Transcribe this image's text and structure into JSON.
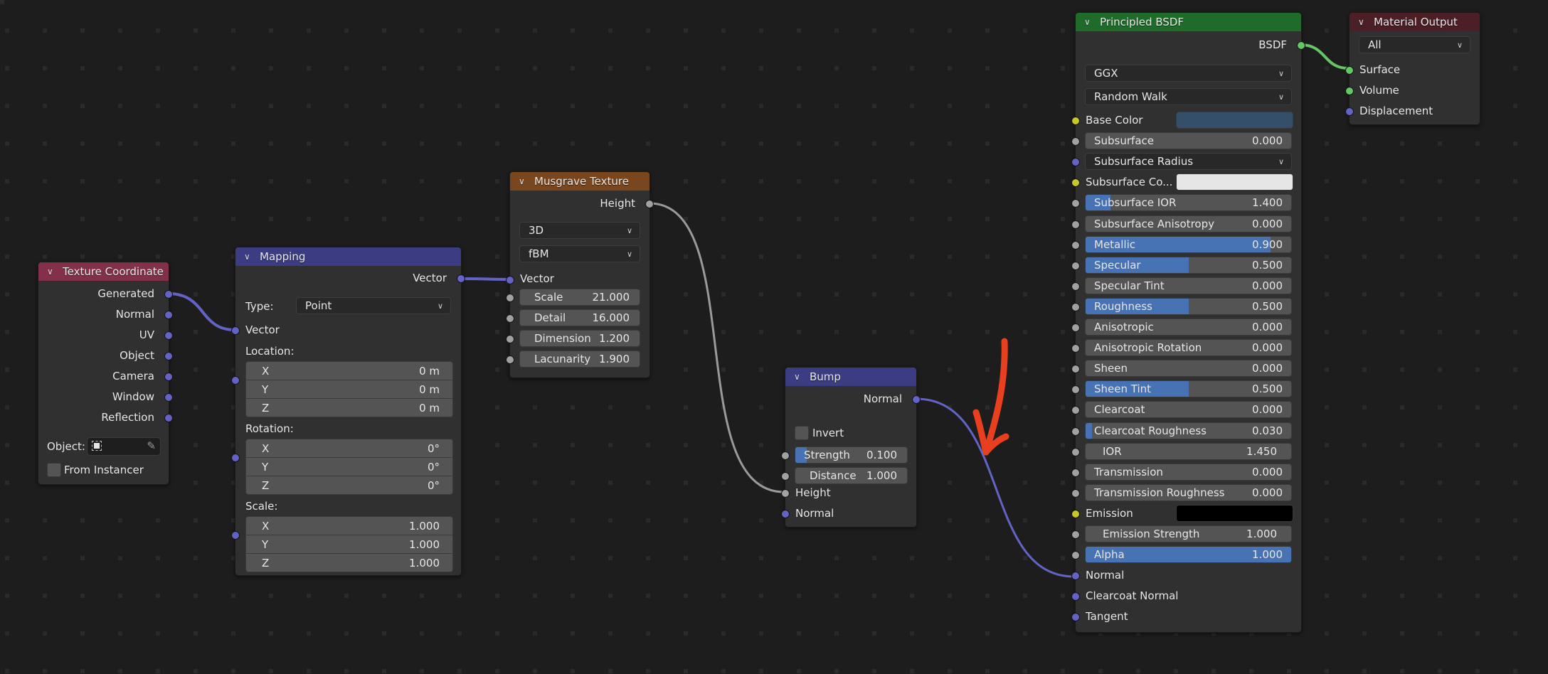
{
  "editor": "Shader Editor",
  "colors": {
    "background": "#1d1d1d",
    "node_body": "#303030",
    "header_input": "#83314a",
    "header_vector": "#3c3c83",
    "header_texture": "#79461d",
    "header_shader": "#1f6b2a",
    "header_output": "#4b1f25",
    "socket_vector": "#6363c7",
    "socket_float": "#a1a1a1",
    "socket_color": "#c7c729",
    "socket_shader": "#63c763",
    "slider_fill": "#4772b3",
    "annotation_arrow": "#e8401f",
    "base_color_swatch": "#344f6a",
    "subsurface_color_swatch": "#e6e6e6",
    "emission_swatch": "#000000"
  },
  "nodes": {
    "texture_coordinate": {
      "title": "Texture Coordinate",
      "outputs": [
        "Generated",
        "Normal",
        "UV",
        "Object",
        "Camera",
        "Window",
        "Reflection"
      ],
      "object_label": "Object:",
      "from_instancer_label": "From Instancer",
      "from_instancer_checked": false
    },
    "mapping": {
      "title": "Mapping",
      "output": "Vector",
      "type_label": "Type:",
      "type_value": "Point",
      "input_vector": "Vector",
      "location_label": "Location:",
      "location": [
        {
          "axis": "X",
          "value": "0 m"
        },
        {
          "axis": "Y",
          "value": "0 m"
        },
        {
          "axis": "Z",
          "value": "0 m"
        }
      ],
      "rotation_label": "Rotation:",
      "rotation": [
        {
          "axis": "X",
          "value": "0°"
        },
        {
          "axis": "Y",
          "value": "0°"
        },
        {
          "axis": "Z",
          "value": "0°"
        }
      ],
      "scale_label": "Scale:",
      "scale": [
        {
          "axis": "X",
          "value": "1.000"
        },
        {
          "axis": "Y",
          "value": "1.000"
        },
        {
          "axis": "Z",
          "value": "1.000"
        }
      ]
    },
    "musgrave": {
      "title": "Musgrave Texture",
      "output": "Height",
      "dimensions": "3D",
      "type": "fBM",
      "input_vector": "Vector",
      "fields": [
        {
          "label": "Scale",
          "value": "21.000"
        },
        {
          "label": "Detail",
          "value": "16.000"
        },
        {
          "label": "Dimension",
          "value": "1.200"
        },
        {
          "label": "Lacunarity",
          "value": "1.900"
        }
      ]
    },
    "bump": {
      "title": "Bump",
      "output": "Normal",
      "invert_label": "Invert",
      "invert_checked": false,
      "strength_label": "Strength",
      "strength_value": "0.100",
      "strength_fill": 0.1,
      "distance_label": "Distance",
      "distance_value": "1.000",
      "input_height": "Height",
      "input_normal": "Normal"
    },
    "principled": {
      "title": "Principled BSDF",
      "output": "BSDF",
      "distribution": "GGX",
      "subsurface_method": "Random Walk",
      "base_color_label": "Base Color",
      "subsurface_radius_label": "Subsurface Radius",
      "subsurface_color_label": "Subsurface Co...",
      "emission_label": "Emission",
      "fields": [
        {
          "label": "Subsurface",
          "value": "0.000",
          "fill": 0
        },
        {
          "label": "Subsurface IOR",
          "value": "1.400",
          "fill": 0.12
        },
        {
          "label": "Subsurface Anisotropy",
          "value": "0.000",
          "fill": 0
        },
        {
          "label": "Metallic",
          "value": "0.900",
          "fill": 0.9
        },
        {
          "label": "Specular",
          "value": "0.500",
          "fill": 0.5
        },
        {
          "label": "Specular Tint",
          "value": "0.000",
          "fill": 0
        },
        {
          "label": "Roughness",
          "value": "0.500",
          "fill": 0.5
        },
        {
          "label": "Anisotropic",
          "value": "0.000",
          "fill": 0
        },
        {
          "label": "Anisotropic Rotation",
          "value": "0.000",
          "fill": 0
        },
        {
          "label": "Sheen",
          "value": "0.000",
          "fill": 0
        },
        {
          "label": "Sheen Tint",
          "value": "0.500",
          "fill": 0.5
        },
        {
          "label": "Clearcoat",
          "value": "0.000",
          "fill": 0
        },
        {
          "label": "Clearcoat Roughness",
          "value": "0.030",
          "fill": 0.03
        },
        {
          "label": "IOR",
          "value": "1.450",
          "fill": 0
        },
        {
          "label": "Transmission",
          "value": "0.000",
          "fill": 0
        },
        {
          "label": "Transmission Roughness",
          "value": "0.000",
          "fill": 0
        },
        {
          "label": "Emission Strength",
          "value": "1.000",
          "fill": 0
        },
        {
          "label": "Alpha",
          "value": "1.000",
          "fill": 1
        }
      ],
      "inputs_bottom": [
        "Normal",
        "Clearcoat Normal",
        "Tangent"
      ]
    },
    "material_output": {
      "title": "Material Output",
      "target": "All",
      "inputs": [
        "Surface",
        "Volume",
        "Displacement"
      ]
    }
  }
}
